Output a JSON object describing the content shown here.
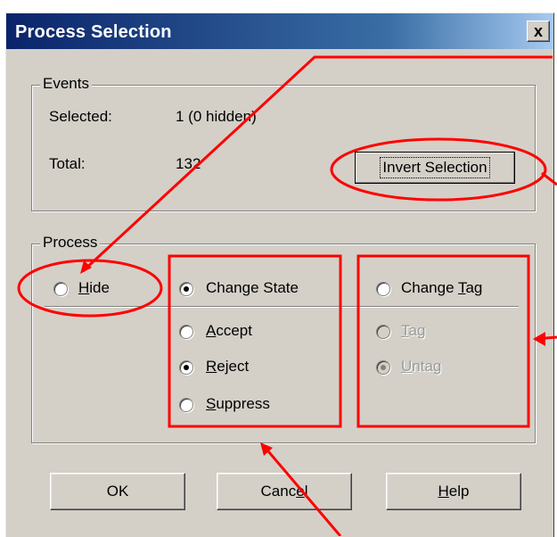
{
  "window": {
    "title": "Process Selection",
    "close_glyph": "x"
  },
  "events": {
    "legend": "Events",
    "selected_label": "Selected:",
    "selected_value": "1  (0 hidden)",
    "total_label": "Total:",
    "total_value": "132",
    "invert_button": "Invert Selection"
  },
  "process": {
    "legend": "Process",
    "hide": {
      "pre": "",
      "accel": "H",
      "post": "ide",
      "checked": false
    },
    "change_state": {
      "label": "Change State",
      "checked": true
    },
    "accept": {
      "pre": "",
      "accel": "A",
      "post": "ccept",
      "checked": false
    },
    "reject": {
      "pre": "",
      "accel": "R",
      "post": "eject",
      "checked": true
    },
    "suppress": {
      "pre": "",
      "accel": "S",
      "post": "uppress",
      "checked": false
    },
    "change_tag": {
      "pre": "Change ",
      "accel": "T",
      "post": "ag",
      "checked": false
    },
    "tag": {
      "pre": "",
      "accel": "T",
      "post": "ag",
      "checked": false,
      "disabled": true
    },
    "untag": {
      "pre": "",
      "accel": "U",
      "post": "ntag",
      "checked": true,
      "disabled": true
    }
  },
  "buttons": {
    "ok": "OK",
    "cancel": {
      "pre": "Canc",
      "accel": "e",
      "post": "l"
    },
    "help": {
      "pre": "",
      "accel": "H",
      "post": "elp"
    }
  },
  "annotation_color": "#ff0000"
}
